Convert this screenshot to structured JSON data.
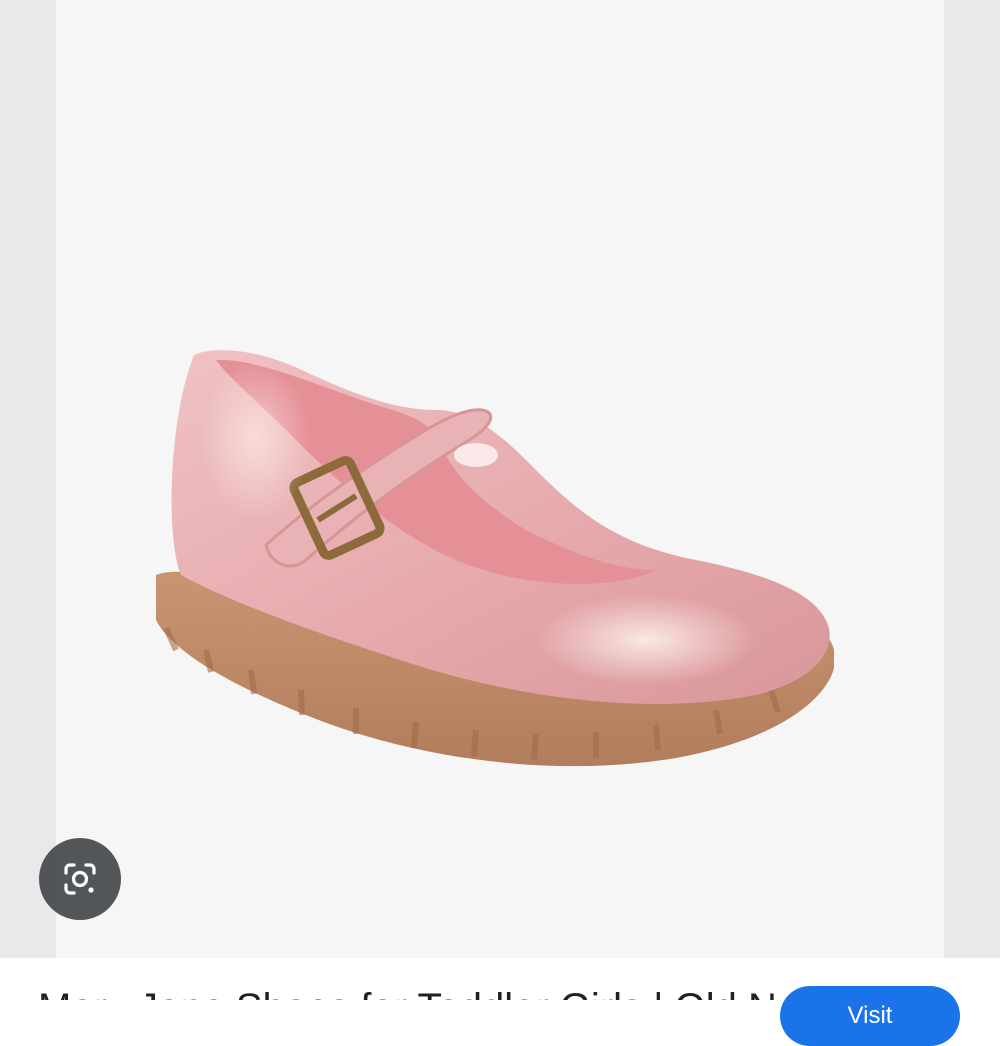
{
  "viewer": {
    "image_alt": "Pink glitter Mary Jane toddler shoe with brass buckle and gum sole",
    "lens_icon": "google-lens-icon"
  },
  "caption": {
    "title": "Mary Jane Shoes for Toddler Girls | Old Navy",
    "visit_label": "Visit"
  },
  "colors": {
    "viewer_background": "#e9e9eb",
    "lens_button": "#3c4043",
    "visit_button": "#1a73e8"
  }
}
